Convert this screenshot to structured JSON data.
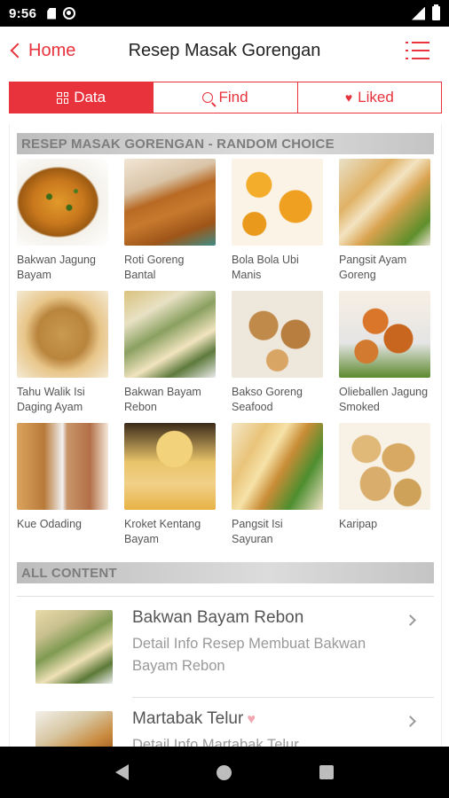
{
  "status_bar": {
    "time": "9:56"
  },
  "header": {
    "back_label": "Home",
    "title": "Resep Masak Gorengan"
  },
  "tabs": [
    {
      "label": "Data",
      "icon": "grid-icon",
      "active": true
    },
    {
      "label": "Find",
      "icon": "search-icon",
      "active": false
    },
    {
      "label": "Liked",
      "icon": "heart-icon",
      "active": false
    }
  ],
  "random_section": {
    "title": "RESEP MASAK GORENGAN - RANDOM CHOICE",
    "items": [
      {
        "name": "Bakwan Jagung Bayam",
        "thumb": "thumb-omelet"
      },
      {
        "name": "Roti Goreng Bantal",
        "thumb": "thumb-rolls"
      },
      {
        "name": "Bola Bola Ubi Manis",
        "thumb": "thumb-balls"
      },
      {
        "name": "Pangsit Ayam Goreng",
        "thumb": "thumb-pangsit"
      },
      {
        "name": "Tahu Walik Isi Daging Ayam",
        "thumb": "thumb-tahu"
      },
      {
        "name": "Bakwan Bayam Rebon",
        "thumb": "thumb-bakwan"
      },
      {
        "name": "Bakso Goreng Seafood",
        "thumb": "thumb-bakso"
      },
      {
        "name": "Olieballen Jagung Smoked",
        "thumb": "thumb-oliebollen"
      },
      {
        "name": "Kue Odading",
        "thumb": "thumb-odading"
      },
      {
        "name": "Kroket Kentang Bayam",
        "thumb": "thumb-kroket"
      },
      {
        "name": "Pangsit Isi Sayuran",
        "thumb": "thumb-sayuran"
      },
      {
        "name": "Karipap",
        "thumb": "thumb-karipap"
      }
    ]
  },
  "all_content": {
    "title": "ALL CONTENT",
    "items": [
      {
        "title": "Bakwan Bayam Rebon",
        "desc": "Detail Info Resep Membuat Bakwan Bayam Rebon",
        "liked": false,
        "thumb": "thumb-list-bakwan"
      },
      {
        "title": "Martabak Telur",
        "desc": "Detail Info Martabak Telur",
        "liked": true,
        "thumb": "thumb-list-martabak"
      }
    ]
  },
  "colors": {
    "accent": "#e8323c",
    "section_header": "#c8c8c8",
    "status_bar": "#000000"
  }
}
